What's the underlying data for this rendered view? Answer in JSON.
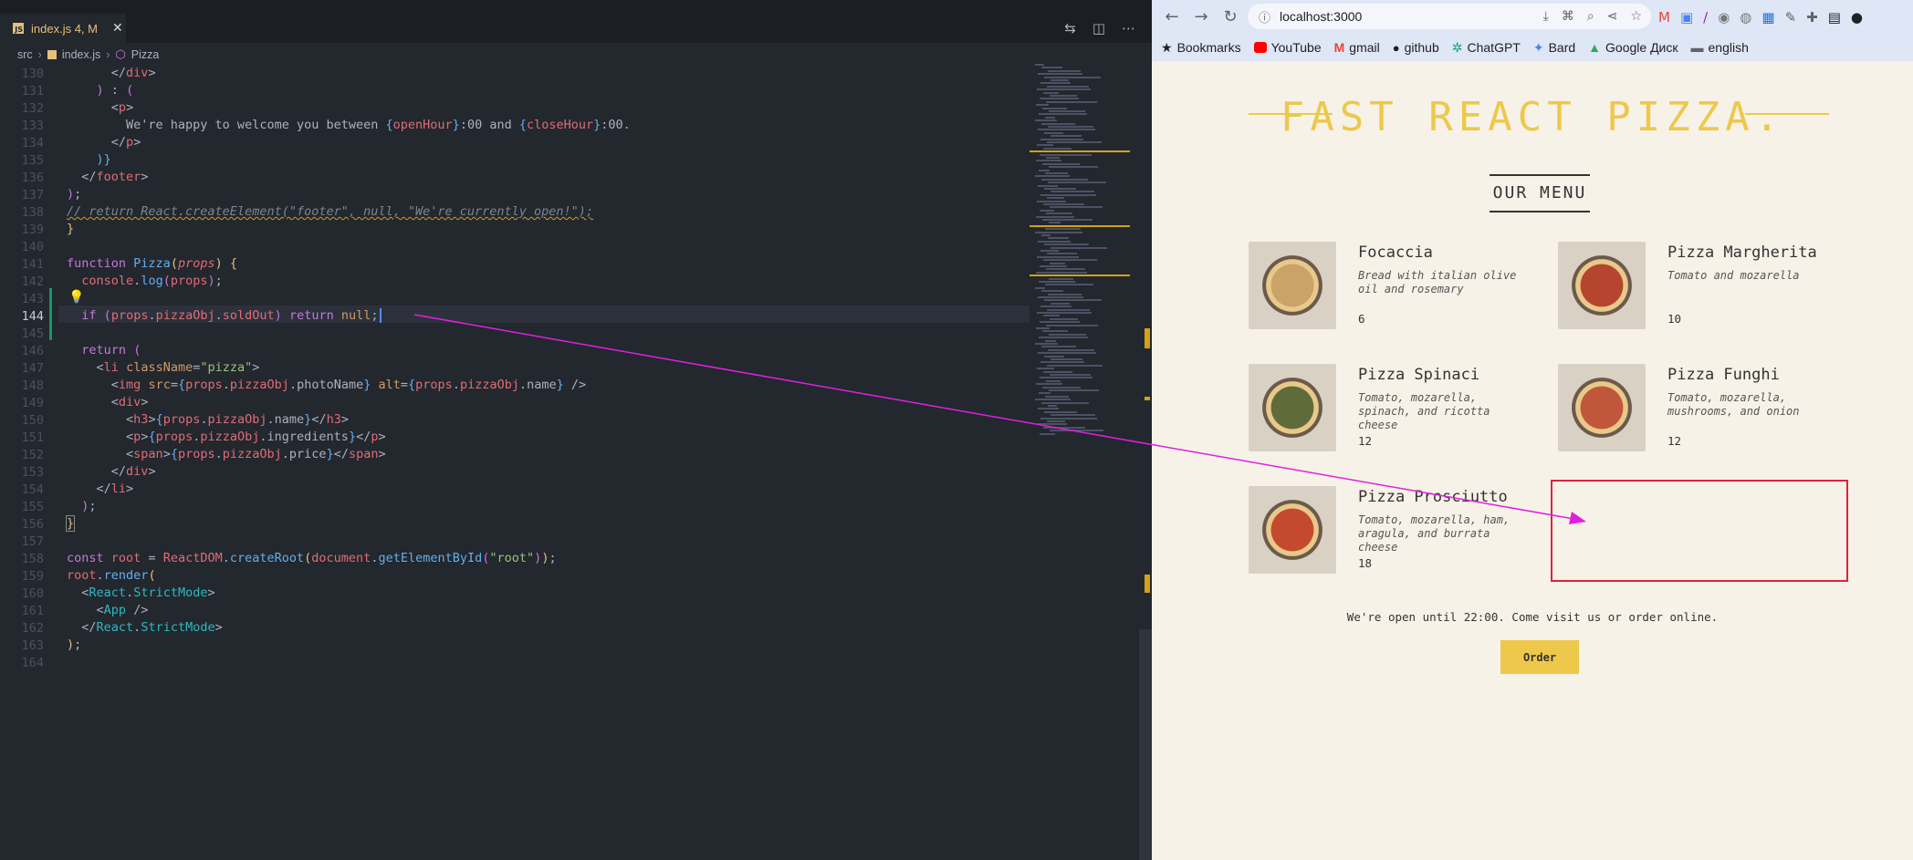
{
  "editor": {
    "tab": {
      "label": "index.js 4, M",
      "badge": "JS"
    },
    "breadcrumb": [
      "src",
      "index.js",
      "Pizza"
    ],
    "active_line": 144,
    "lines": [
      {
        "n": "130",
        "html": "      <span class=\"p\">&lt;/</span><span class=\"t\">div</span><span class=\"p\">&gt;</span>"
      },
      {
        "n": "131",
        "html": "    <span class=\"br2\">)</span> <span class=\"p\">:</span> <span class=\"br2\">(</span>"
      },
      {
        "n": "132",
        "html": "      <span class=\"p\">&lt;</span><span class=\"t\">p</span><span class=\"p\">&gt;</span>"
      },
      {
        "n": "133",
        "html": "        We're happy to welcome you between <span class=\"br3\">{</span><span class=\"t\">openHour</span><span class=\"br3\">}</span>:00 and <span class=\"br3\">{</span><span class=\"t\">closeHour</span><span class=\"br3\">}</span>:00."
      },
      {
        "n": "134",
        "html": "      <span class=\"p\">&lt;/</span><span class=\"t\">p</span><span class=\"p\">&gt;</span>"
      },
      {
        "n": "135",
        "html": "    <span class=\"br3\">)}</span>"
      },
      {
        "n": "136",
        "html": "  <span class=\"p\">&lt;/</span><span class=\"t\">footer</span><span class=\"p\">&gt;</span>"
      },
      {
        "n": "137",
        "html": "<span class=\"br2\">)</span>;"
      },
      {
        "n": "138",
        "html": "<span class=\"c\">// return React.createElement(\"footer\", null, \"We're currently open!\");</span>"
      },
      {
        "n": "139",
        "html": "<span class=\"br\">}</span>"
      },
      {
        "n": "140",
        "html": ""
      },
      {
        "n": "141",
        "html": "<span class=\"k\">function</span> <span class=\"f\">Pizza</span><span class=\"br\">(</span><span class=\"pi\">props</span><span class=\"br\">)</span> <span class=\"br\">{</span>"
      },
      {
        "n": "142",
        "html": "  <span class=\"t\">console</span>.<span class=\"f\">log</span><span class=\"br2\">(</span><span class=\"t\">props</span><span class=\"br2\">)</span>;"
      },
      {
        "n": "143",
        "html": ""
      },
      {
        "n": "144",
        "html": "  <span class=\"k\">if</span> <span class=\"br2\">(</span><span class=\"t\">props</span>.<span class=\"t\">pizzaObj</span>.<span class=\"t\">soldOut</span><span class=\"br2\">)</span> <span class=\"k\">return</span> <span class=\"a\">null</span>;"
      },
      {
        "n": "145",
        "html": ""
      },
      {
        "n": "146",
        "html": "  <span class=\"k\">return</span> <span class=\"br2\">(</span>"
      },
      {
        "n": "147",
        "html": "    <span class=\"p\">&lt;</span><span class=\"t\">li</span> <span class=\"a\">className</span>=<span class=\"s\">\"pizza\"</span><span class=\"p\">&gt;</span>"
      },
      {
        "n": "148",
        "html": "      <span class=\"p\">&lt;</span><span class=\"t\">img</span> <span class=\"a\">src</span>=<span class=\"br3\">{</span><span class=\"t\">props</span>.<span class=\"t\">pizzaObj</span>.photoName<span class=\"br3\">}</span> <span class=\"a\">alt</span>=<span class=\"br3\">{</span><span class=\"t\">props</span>.<span class=\"t\">pizzaObj</span>.name<span class=\"br3\">}</span> <span class=\"p\">/&gt;</span>"
      },
      {
        "n": "149",
        "html": "      <span class=\"p\">&lt;</span><span class=\"t\">div</span><span class=\"p\">&gt;</span>"
      },
      {
        "n": "150",
        "html": "        <span class=\"p\">&lt;</span><span class=\"t\">h3</span><span class=\"p\">&gt;</span><span class=\"br3\">{</span><span class=\"t\">props</span>.<span class=\"t\">pizzaObj</span>.name<span class=\"br3\">}</span><span class=\"p\">&lt;/</span><span class=\"t\">h3</span><span class=\"p\">&gt;</span>"
      },
      {
        "n": "151",
        "html": "        <span class=\"p\">&lt;</span><span class=\"t\">p</span><span class=\"p\">&gt;</span><span class=\"br3\">{</span><span class=\"t\">props</span>.<span class=\"t\">pizzaObj</span>.ingredients<span class=\"br3\">}</span><span class=\"p\">&lt;/</span><span class=\"t\">p</span><span class=\"p\">&gt;</span>"
      },
      {
        "n": "152",
        "html": "        <span class=\"p\">&lt;</span><span class=\"t\">span</span><span class=\"p\">&gt;</span><span class=\"br3\">{</span><span class=\"t\">props</span>.<span class=\"t\">pizzaObj</span>.price<span class=\"br3\">}</span><span class=\"p\">&lt;/</span><span class=\"t\">span</span><span class=\"p\">&gt;</span>"
      },
      {
        "n": "153",
        "html": "      <span class=\"p\">&lt;/</span><span class=\"t\">div</span><span class=\"p\">&gt;</span>"
      },
      {
        "n": "154",
        "html": "    <span class=\"p\">&lt;/</span><span class=\"t\">li</span><span class=\"p\">&gt;</span>"
      },
      {
        "n": "155",
        "html": "  <span class=\"br2\">)</span>;"
      },
      {
        "n": "156",
        "html": "<span class=\"br\" style=\"outline:1px solid #888;\">}</span>"
      },
      {
        "n": "157",
        "html": ""
      },
      {
        "n": "158",
        "html": "<span class=\"k\">const</span> <span class=\"t\">root</span> = <span class=\"t\">ReactDOM</span>.<span class=\"f\">createRoot</span><span class=\"br\">(</span><span class=\"t\">document</span>.<span class=\"f\">getElementById</span><span class=\"br2\">(</span><span class=\"s\">\"root\"</span><span class=\"br2\">)</span><span class=\"br\">)</span>;"
      },
      {
        "n": "159",
        "html": "<span class=\"t\">root</span>.<span class=\"f\">render</span><span class=\"br\">(</span>"
      },
      {
        "n": "160",
        "html": "  <span class=\"p\">&lt;</span><span class=\"cb\">React</span>.<span class=\"cb\">StrictMode</span><span class=\"p\">&gt;</span>"
      },
      {
        "n": "161",
        "html": "    <span class=\"p\">&lt;</span><span class=\"cb\">App</span> <span class=\"p\">/&gt;</span>"
      },
      {
        "n": "162",
        "html": "  <span class=\"p\">&lt;/</span><span class=\"cb\">React</span>.<span class=\"cb\">StrictMode</span><span class=\"p\">&gt;</span>"
      },
      {
        "n": "163",
        "html": "<span class=\"br\">)</span>;"
      },
      {
        "n": "164",
        "html": ""
      }
    ]
  },
  "browser": {
    "url": "localhost:3000",
    "bookmarks": [
      {
        "label": "Bookmarks",
        "icon": "star-icon",
        "color": "#202124"
      },
      {
        "label": "YouTube",
        "icon": "youtube-icon",
        "color": "#ff0000"
      },
      {
        "label": "gmail",
        "icon": "gmail-icon",
        "color": "#ea4335"
      },
      {
        "label": "github",
        "icon": "github-icon",
        "color": "#202124"
      },
      {
        "label": "ChatGPT",
        "icon": "chatgpt-icon",
        "color": "#10a37f"
      },
      {
        "label": "Bard",
        "icon": "bard-icon",
        "color": "#4285f4"
      },
      {
        "label": "Google Диск",
        "icon": "google-drive-icon",
        "color": "#34a853"
      },
      {
        "label": "english",
        "icon": "folder-icon",
        "color": "#5f6368"
      }
    ]
  },
  "page": {
    "headline": "FAST REACT PIZZA.",
    "menu_title": "OUR MENU",
    "pizzas": [
      {
        "name": "Focaccia",
        "ingredients": "Bread with italian olive oil and rosemary",
        "price": "6",
        "color": "#c9a36a"
      },
      {
        "name": "Pizza Margherita",
        "ingredients": "Tomato and mozarella",
        "price": "10",
        "color": "#b5452e"
      },
      {
        "name": "Pizza Spinaci",
        "ingredients": "Tomato, mozarella, spinach, and ricotta cheese",
        "price": "12",
        "color": "#5f6b3a"
      },
      {
        "name": "Pizza Funghi",
        "ingredients": "Tomato, mozarella, mushrooms, and onion",
        "price": "12",
        "color": "#c0573a"
      },
      {
        "name": "Pizza Prosciutto",
        "ingredients": "Tomato, mozarella, ham, aragula, and burrata cheese",
        "price": "18",
        "color": "#c4492e"
      }
    ],
    "footer": "We're open until 22:00. Come visit us or order online.",
    "order_button": "Order"
  },
  "annotation": {
    "arrow_color": "#e020e0",
    "box_color": "#e0213c"
  }
}
